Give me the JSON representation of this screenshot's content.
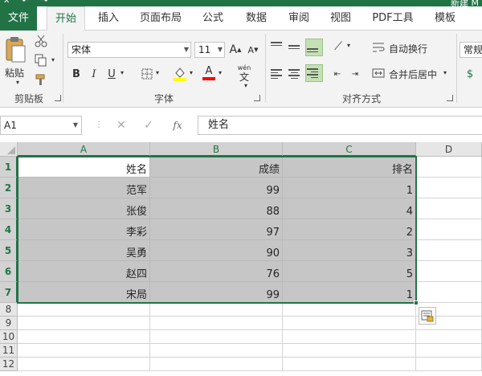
{
  "window": {
    "title": "新建 M"
  },
  "tabs": [
    {
      "label": "文件"
    },
    {
      "label": "开始"
    },
    {
      "label": "插入"
    },
    {
      "label": "页面布局"
    },
    {
      "label": "公式"
    },
    {
      "label": "数据"
    },
    {
      "label": "审阅"
    },
    {
      "label": "视图"
    },
    {
      "label": "PDF工具"
    },
    {
      "label": "模板"
    }
  ],
  "ribbon": {
    "clipboard": {
      "group_label": "剪贴板",
      "paste_label": "粘贴"
    },
    "font": {
      "group_label": "字体",
      "font_name": "宋体",
      "font_size": "11",
      "bold": "B",
      "italic": "I",
      "underline": "U",
      "grow": "A",
      "shrink": "A",
      "font_color_glyph": "A",
      "phonetic_top": "wén",
      "phonetic_bottom": "文",
      "fill_color": "#ffff00",
      "font_color": "#ff0000"
    },
    "alignment": {
      "group_label": "对齐方式",
      "wrap_text": "自动换行",
      "merge_center": "合并后居中"
    },
    "number": {
      "format": "常规"
    }
  },
  "formula_bar": {
    "name_box": "A1",
    "fx": "fx",
    "cancel": "✕",
    "enter": "✓",
    "content": "姓名"
  },
  "sheet": {
    "columns": [
      "A",
      "B",
      "C",
      "D"
    ],
    "rows": [
      "1",
      "2",
      "3",
      "4",
      "5",
      "6",
      "7",
      "8",
      "9",
      "10",
      "11",
      "12"
    ],
    "cells": [
      [
        "姓名",
        "成绩",
        "排名"
      ],
      [
        "范军",
        "99",
        "1"
      ],
      [
        "张俊",
        "88",
        "4"
      ],
      [
        "李彩",
        "97",
        "2"
      ],
      [
        "吴勇",
        "90",
        "3"
      ],
      [
        "赵四",
        "76",
        "5"
      ],
      [
        "宋局",
        "99",
        "1"
      ]
    ]
  },
  "colors": {
    "accent": "#217346",
    "selection_fill": "#c6c6c6"
  }
}
